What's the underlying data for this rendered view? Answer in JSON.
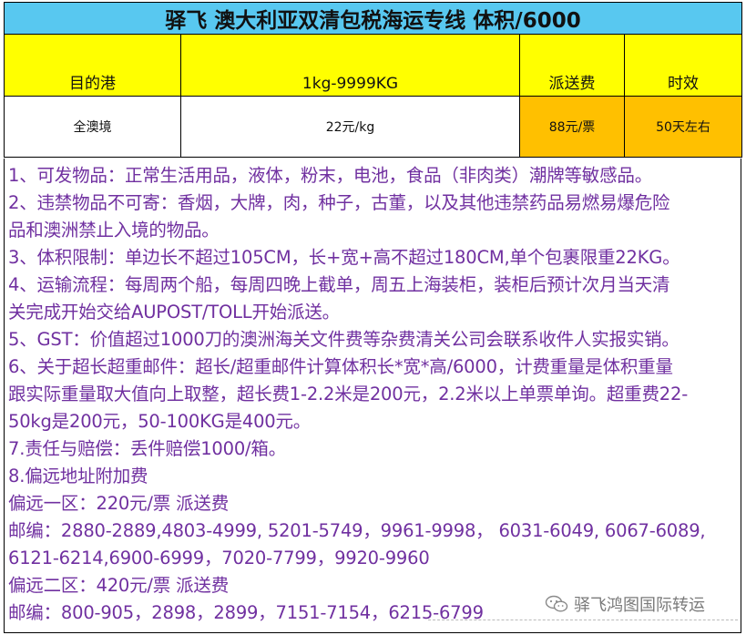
{
  "title": "驿飞 澳大利亚双清包税海运专线 体积/6000",
  "headers": {
    "destination": "目的港",
    "weight": "1kg-9999KG",
    "delivery_fee": "派送费",
    "transit_time": "时效"
  },
  "row": {
    "destination": "全澳境",
    "price": "22元/kg",
    "delivery_fee": "88元/票",
    "transit_time": "50天左右"
  },
  "notes": [
    "1、可发物品：正常生活用品，液体，粉末，电池，食品（非肉类）潮牌等敏感品。",
    "2、违禁物品不可寄：香烟，大牌，肉，种子，古董，以及其他违禁药品易燃易爆危险",
    "品和澳洲禁止入境的物品。",
    "3、体积限制：单边长不超过105CM，长+宽+高不超过180CM,单个包裹限重22KG。",
    "4、运输流程：每周两个船，每周四晚上截单，周五上海装柜，装柜后预计次月当天清",
    "关完成开始交给AUPOST/TOLL开始派送。",
    "5、GST：价值超过1000刀的澳洲海关文件费等杂费清关公司会联系收件人实报实销。",
    "6、关于超长超重邮件：超长/超重邮件计算体积长*宽*高/6000，计费重量是体积重量",
    "跟实际重量取大值向上取整，超长费1-2.2米是200元，2.2米以上单票单询。超重费22-",
    "50kg是200元，50-100KG是400元。",
    "7.责任与赔偿：丢件赔偿1000/箱。",
    "8.偏远地址附加费",
    "偏远一区：220元/票  派送费",
    "邮编：2880-2889,4803-4999, 5201-5749，9961-9998， 6031-6049, 6067-6089,",
    "6121-6214,6900-6999，7020-7799，9920-9960",
    "偏远二区：420元/票  派送费",
    "邮编：800-905，2898，2899，7151-7154，6215-6799"
  ],
  "watermark": {
    "text": "驿飞鸿图国际转运",
    "icon": "wechat-icon"
  },
  "colors": {
    "title_bg": "#58c8f0",
    "header_bg": "#ffff00",
    "highlight_bg": "#ffc000",
    "notes_text": "#7030a0"
  }
}
